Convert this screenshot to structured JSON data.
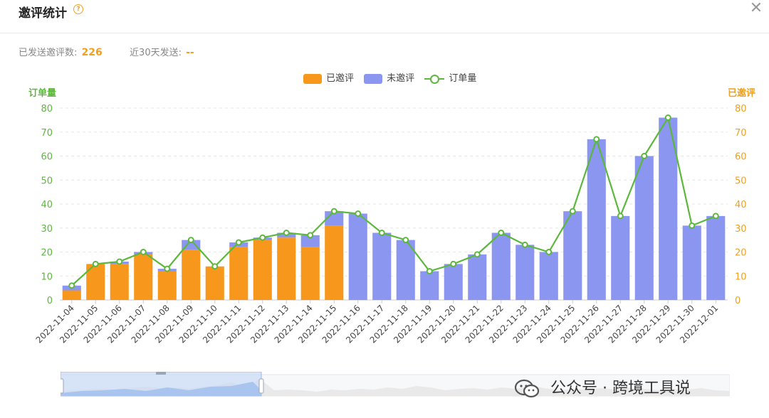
{
  "header": {
    "title": "邀评统计",
    "help_icon": "question-icon",
    "close_icon": "close-icon"
  },
  "stats": {
    "sent_label": "已发送邀评数:",
    "sent_value": "226",
    "recent_label": "近30天发送:",
    "recent_value": "--"
  },
  "legend": {
    "reviewed": "已邀评",
    "unreviewed": "未邀评",
    "orders": "订单量"
  },
  "colors": {
    "reviewed": "#f7981d",
    "unreviewed": "#8a96f0",
    "orders": "#5cb83c",
    "left_axis": "#5cb83c",
    "right_axis": "#f0a020"
  },
  "watermark": {
    "text": "公众号 · 跨境工具说"
  },
  "chart_data": {
    "type": "bar",
    "stacked": true,
    "categories": [
      "2022-11-04",
      "2022-11-05",
      "2022-11-06",
      "2022-11-07",
      "2022-11-08",
      "2022-11-09",
      "2022-11-10",
      "2022-11-11",
      "2022-11-12",
      "2022-11-13",
      "2022-11-14",
      "2022-11-15",
      "2022-11-16",
      "2022-11-17",
      "2022-11-18",
      "2022-11-19",
      "2022-11-20",
      "2022-11-21",
      "2022-11-22",
      "2022-11-23",
      "2022-11-24",
      "2022-11-25",
      "2022-11-26",
      "2022-11-27",
      "2022-11-28",
      "2022-11-29",
      "2022-11-30",
      "2022-12-01"
    ],
    "series": [
      {
        "name": "已邀评",
        "type": "bar",
        "values": [
          4,
          15,
          15,
          19,
          12,
          21,
          14,
          22,
          25,
          26,
          22,
          31,
          0,
          0,
          0,
          0,
          0,
          0,
          0,
          0,
          0,
          0,
          0,
          0,
          0,
          0,
          0,
          0
        ]
      },
      {
        "name": "未邀评",
        "type": "bar",
        "values": [
          2,
          0,
          1,
          1,
          1,
          4,
          0,
          2,
          1,
          2,
          5,
          6,
          36,
          28,
          25,
          12,
          15,
          19,
          28,
          23,
          20,
          37,
          67,
          35,
          60,
          76,
          31,
          35
        ]
      },
      {
        "name": "订单量",
        "type": "line",
        "values": [
          6,
          15,
          16,
          20,
          13,
          25,
          14,
          24,
          26,
          28,
          27,
          37,
          36,
          28,
          25,
          12,
          15,
          19,
          28,
          23,
          20,
          37,
          67,
          35,
          60,
          76,
          31,
          35
        ]
      }
    ],
    "ylabel": "订单量",
    "ylabel_right": "已邀评",
    "ylim": [
      0,
      80
    ],
    "yticks": [
      0,
      10,
      20,
      30,
      40,
      50,
      60,
      70,
      80
    ],
    "grid": true,
    "legend_position": "top-center"
  }
}
